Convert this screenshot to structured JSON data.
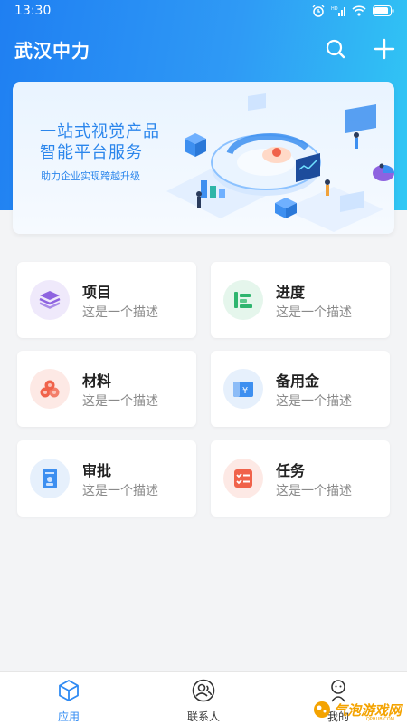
{
  "status_bar": {
    "time": "13:30"
  },
  "app_bar": {
    "title": "武汉中力"
  },
  "banner": {
    "line1": "一站式视觉产品",
    "line2": "智能平台服务",
    "subtitle": "助力企业实现跨越升级"
  },
  "cards": [
    {
      "title": "项目",
      "desc": "这是一个描述",
      "icon": "layers-icon",
      "color": "#8e63e0",
      "bg": "#efe9fb"
    },
    {
      "title": "进度",
      "desc": "这是一个描述",
      "icon": "progress-icon",
      "color": "#2fb56f",
      "bg": "#e5f6ec"
    },
    {
      "title": "材料",
      "desc": "这是一个描述",
      "icon": "materials-icon",
      "color": "#f0624a",
      "bg": "#fde9e5"
    },
    {
      "title": "备用金",
      "desc": "这是一个描述",
      "icon": "reserve-fund-icon",
      "color": "#3d8ff0",
      "bg": "#e6f0fc"
    },
    {
      "title": "审批",
      "desc": "这是一个描述",
      "icon": "approval-icon",
      "color": "#3d8ff0",
      "bg": "#e6f0fc"
    },
    {
      "title": "任务",
      "desc": "这是一个描述",
      "icon": "task-icon",
      "color": "#f0624a",
      "bg": "#fde9e5"
    }
  ],
  "tabs": [
    {
      "label": "应用",
      "icon": "cube-icon",
      "active": true
    },
    {
      "label": "联系人",
      "icon": "contacts-icon",
      "active": false
    },
    {
      "label": "我的",
      "icon": "profile-icon",
      "active": false
    }
  ],
  "watermark": {
    "text": "气泡游戏网",
    "sub": "QPHUB.COM"
  },
  "colors": {
    "primary": "#2f8af3",
    "inactive_tab": "#333333"
  }
}
